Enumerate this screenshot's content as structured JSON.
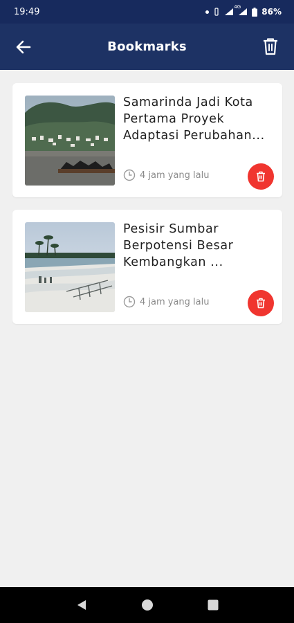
{
  "status_bar": {
    "time": "19:49",
    "network": "4G",
    "battery": "86%"
  },
  "app_bar": {
    "title": "Bookmarks",
    "back_icon": "arrow-left-icon",
    "trash_icon": "trash-icon"
  },
  "bookmarks": [
    {
      "title": "Samarinda Jadi Kota Pertama Proyek Adaptasi Perubahan...",
      "time": "4 jam yang lalu",
      "image": "river-town-photo"
    },
    {
      "title": "Pesisir Sumbar Berpotensi Besar Kembangkan ...",
      "time": "4 jam yang lalu",
      "image": "coastal-beach-photo"
    }
  ],
  "colors": {
    "status_bar": "#172a5d",
    "app_bar": "#1d3264",
    "delete_button": "#f0352f",
    "background": "#f0f0f0"
  }
}
